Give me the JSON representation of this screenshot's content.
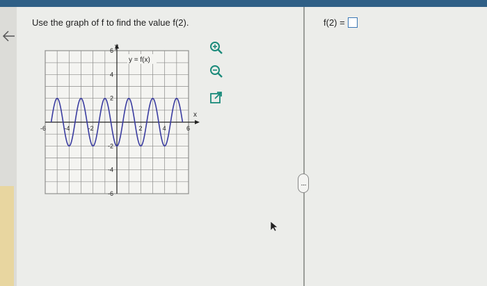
{
  "question": {
    "text": "Use the graph of f to find the value f(2)."
  },
  "answer": {
    "label": "f(2) ="
  },
  "graph": {
    "function_label": "y = f(x)",
    "x_axis_label": "x",
    "y_axis_label": "y",
    "x_ticks": [
      "-6",
      "-4",
      "-2",
      "2",
      "4",
      "6"
    ],
    "y_ticks": [
      "6",
      "4",
      "2",
      "-2",
      "-4",
      "-6"
    ],
    "xlim": [
      -6,
      6
    ],
    "ylim": [
      -6,
      6
    ],
    "curve": {
      "type": "sinusoid",
      "amplitude": 2,
      "period": 2,
      "x_range": [
        -5.5,
        5.5
      ],
      "color": "#3a3ca0"
    }
  },
  "tools": {
    "zoom_in": "zoom-in-icon",
    "zoom_out": "zoom-out-icon",
    "open_external": "external-link-icon"
  },
  "splitter": {
    "label": "....."
  },
  "colors": {
    "accent": "#2f5f86",
    "link": "#3a77b5",
    "tool": "#1a8a7a"
  }
}
